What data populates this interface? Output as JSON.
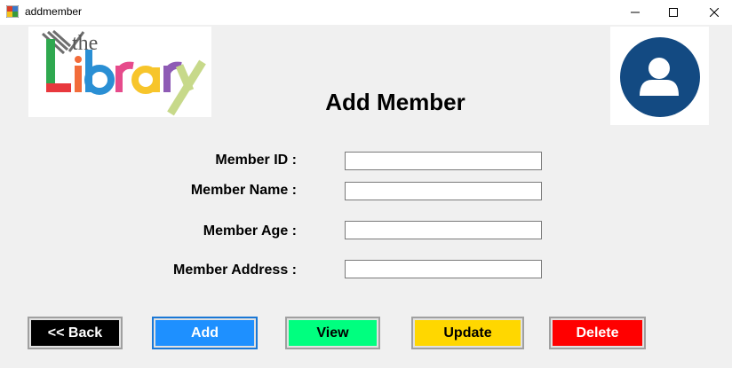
{
  "window": {
    "title": "addmember"
  },
  "logo": {
    "word_the": "the",
    "word_library": "Library"
  },
  "page": {
    "title": "Add Member"
  },
  "form": {
    "member_id_label": "Member ID :",
    "member_id_value": "",
    "member_name_label": "Member Name :",
    "member_name_value": "",
    "member_age_label": "Member Age :",
    "member_age_value": "",
    "member_address_label": "Member Address :",
    "member_address_value": ""
  },
  "buttons": {
    "back": "<< Back",
    "add": "Add",
    "view": "View",
    "update": "Update",
    "delete": "Delete"
  },
  "colors": {
    "back": "#000000",
    "add": "#1e90ff",
    "view": "#00ff7f",
    "update": "#ffd700",
    "delete": "#ff0000",
    "avatar": "#134a82"
  }
}
